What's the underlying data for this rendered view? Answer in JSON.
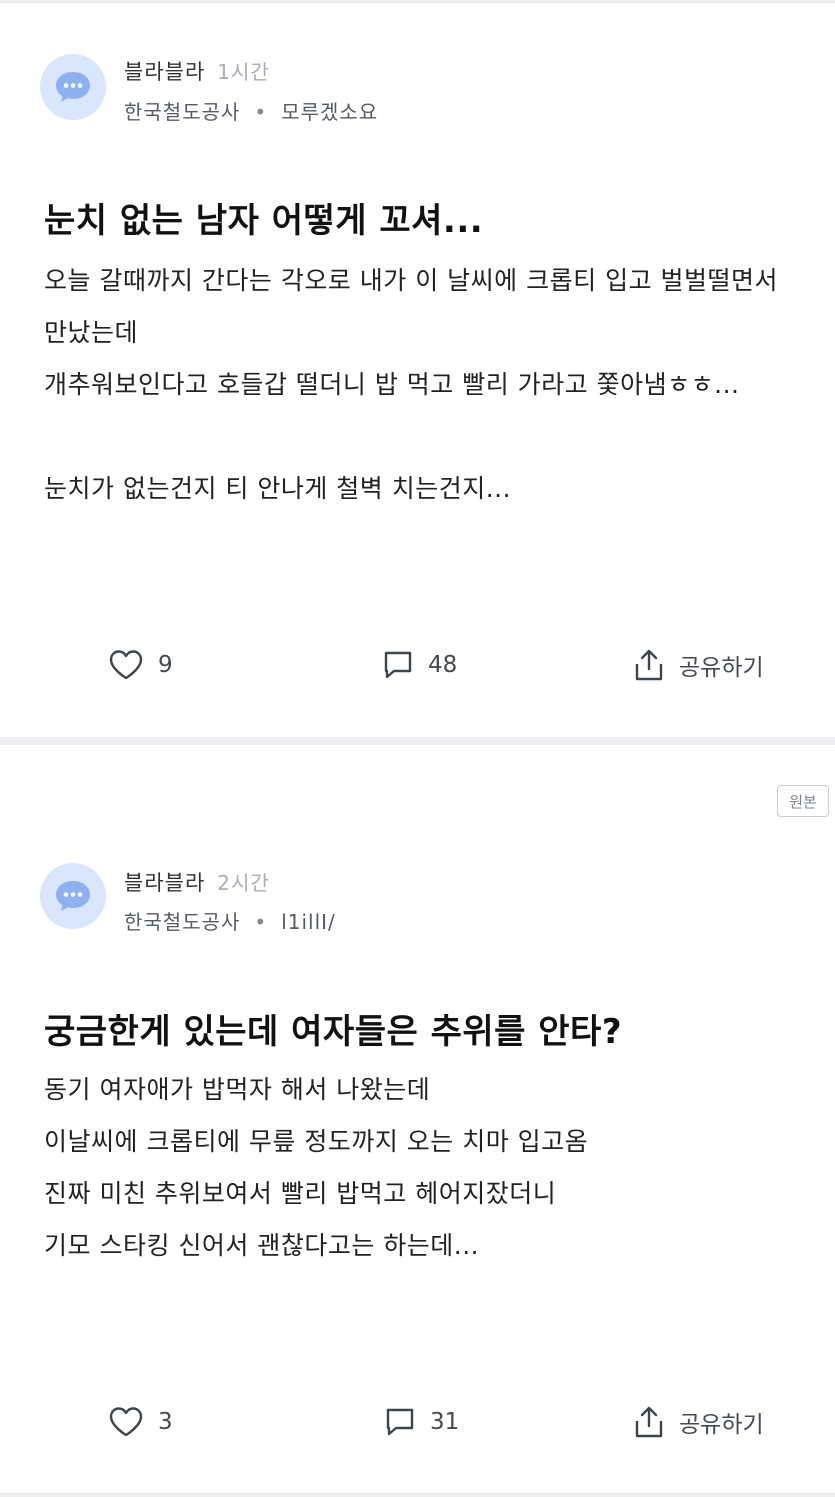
{
  "posts": [
    {
      "author": "블라블라",
      "time": "1시간",
      "company": "한국철도공사",
      "nickname": "모루겠소요",
      "title": "눈치 없는 남자 어떻게 꼬셔...",
      "body_lines": [
        "오늘 갈때까지 간다는 각오로 내가 이 날씨에 크롭티 입고 벌벌떨면서",
        "만났는데",
        "개추워보인다고 호들갑 떨더니 밥 먹고 빨리 가라고 쫓아냄ㅎㅎ...",
        "",
        "눈치가 없는건지 티 안나게 철벽 치는건지..."
      ],
      "likes": "9",
      "comments": "48",
      "share_label": "공유하기"
    },
    {
      "badge": "원본",
      "author": "블라블라",
      "time": "2시간",
      "company": "한국철도공사",
      "nickname": "l1illI/",
      "title": "궁금한게 있는데 여자들은 추위를 안타?",
      "body_lines": [
        "동기 여자애가 밥먹자 해서 나왔는데",
        "이날씨에 크롭티에 무릎 정도까지 오는 치마 입고옴",
        "진짜 미친 추위보여서 빨리 밥먹고 헤어지잤더니",
        "기모 스타킹 신어서 괜찮다고는 하는데..."
      ],
      "likes": "3",
      "comments": "31",
      "share_label": "공유하기"
    }
  ],
  "icons": {
    "avatar": "chat-bubble-icon",
    "like": "heart-icon",
    "comment": "comment-icon",
    "share": "share-icon"
  },
  "colors": {
    "avatar_bg": "#d9e6fb",
    "avatar_bubble": "#8fb0ee",
    "divider": "#eceef1",
    "muted": "#a9aeb6"
  }
}
